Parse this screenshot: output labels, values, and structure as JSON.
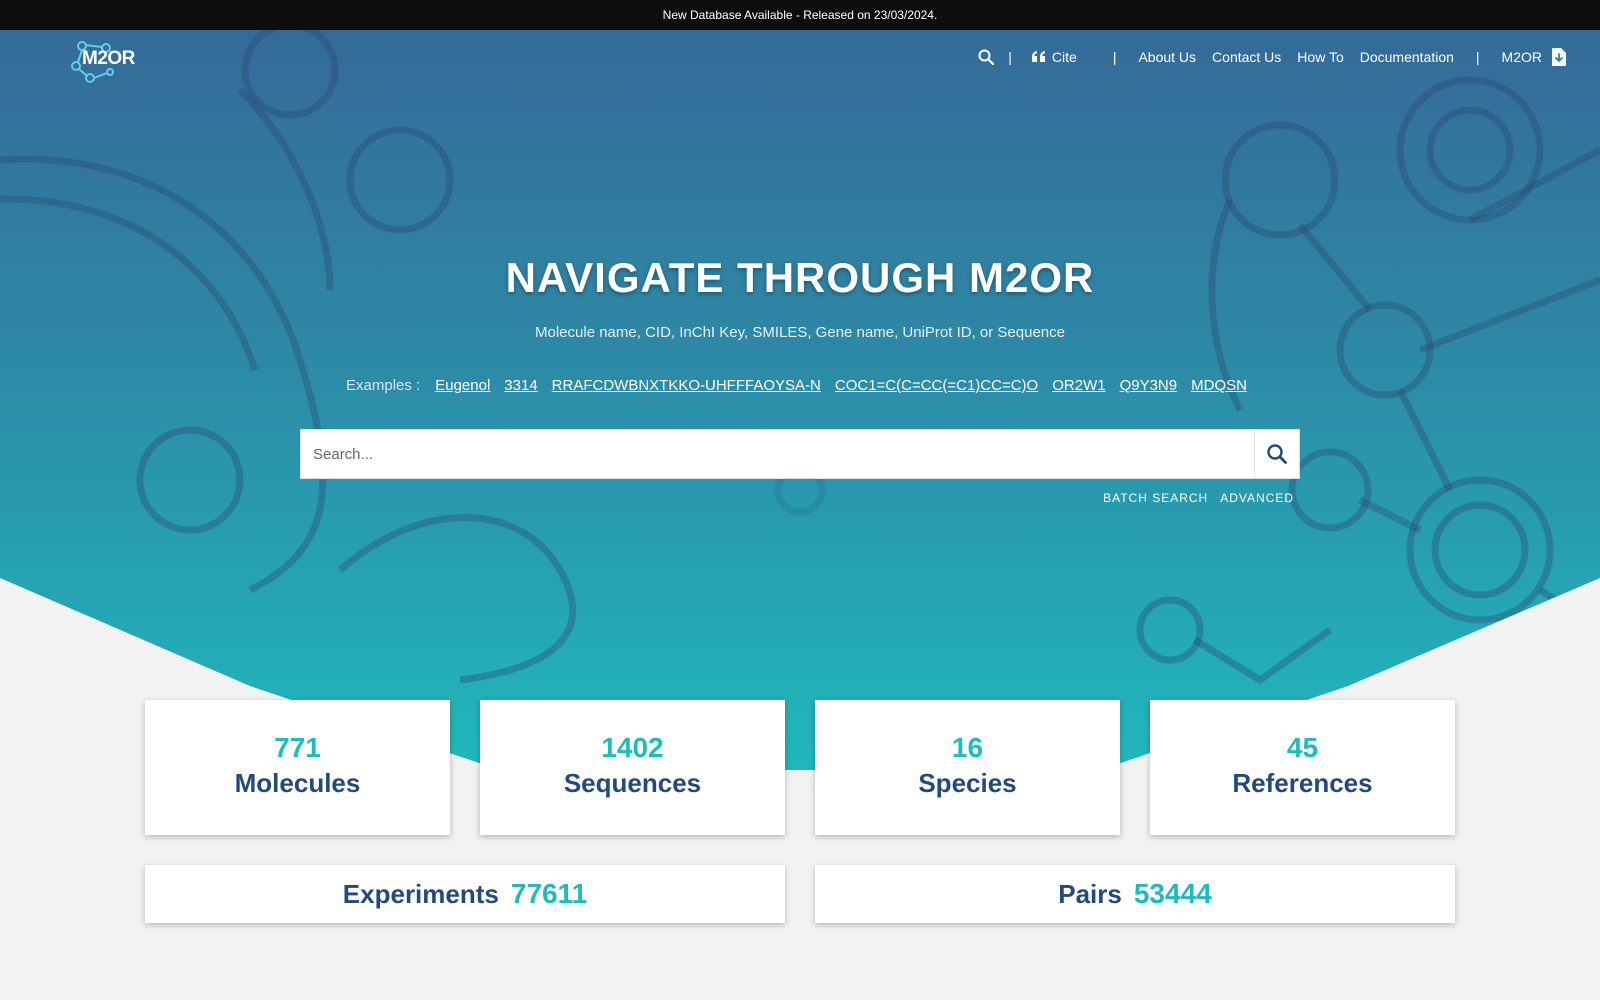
{
  "banner": {
    "text": "New Database Available - Released on 23/03/2024."
  },
  "header": {
    "logo_text": "M2OR",
    "separator": "|",
    "cite_label": "Cite",
    "links": [
      "About Us",
      "Contact Us",
      "How To",
      "Documentation"
    ],
    "download_label": "M2OR"
  },
  "hero": {
    "title": "NAVIGATE THROUGH M2OR",
    "subtitle": "Molecule name, CID, InChI Key, SMILES, Gene name, UniProt ID, or Sequence",
    "examples_label": "Examples :",
    "examples": [
      "Eugenol",
      "3314",
      "RRAFCDWBNXTKKO-UHFFFAOYSA-N",
      "COC1=C(C=CC(=C1)CC=C)O",
      "OR2W1",
      "Q9Y3N9",
      "MDQSN"
    ]
  },
  "search": {
    "placeholder": "Search...",
    "batch_label": "BATCH SEARCH",
    "advanced_label": "ADVANCED"
  },
  "stats": [
    {
      "value": "771",
      "label": "Molecules"
    },
    {
      "value": "1402",
      "label": "Sequences"
    },
    {
      "value": "16",
      "label": "Species"
    },
    {
      "value": "45",
      "label": "References"
    }
  ],
  "totals": [
    {
      "label": "Experiments",
      "value": "77611"
    },
    {
      "label": "Pairs",
      "value": "53444"
    }
  ],
  "colors": {
    "accent": "#20bcbc",
    "navy": "#23497d",
    "banner_bg": "#0e0e0e",
    "page_bg": "#f2f2f2"
  },
  "icons": {
    "search": "search-icon",
    "cite": "quote-icon",
    "download": "file-download-icon",
    "logo": "molecule-logo-icon"
  }
}
